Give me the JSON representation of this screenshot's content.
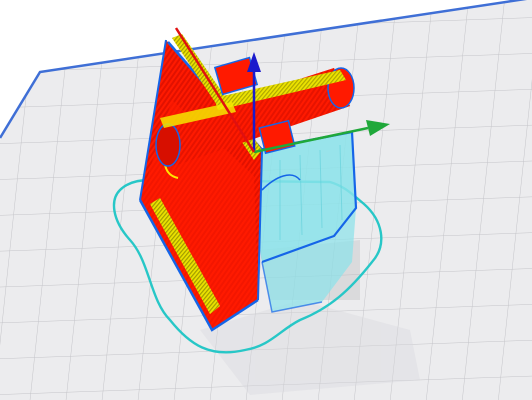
{
  "viewport": {
    "view_mode": "layer-preview",
    "background_color": "#ffffff"
  },
  "build_plate": {
    "grid": true,
    "plate_color": "#ececee",
    "grid_color": "#c4c4c8",
    "edge_color": "#3f6fd6"
  },
  "model": {
    "outer_wall_color": "#ff1a00",
    "inner_wall_color": "#f2e600",
    "infill_color": "#e8e000",
    "support_color": "#8ae3ea",
    "support_outline_color": "#1565e8",
    "skirt_color": "#27c7c7"
  },
  "axes": {
    "x_color": "#1fa83a",
    "y_color": "#e01010",
    "z_color": "#1a1acc"
  }
}
